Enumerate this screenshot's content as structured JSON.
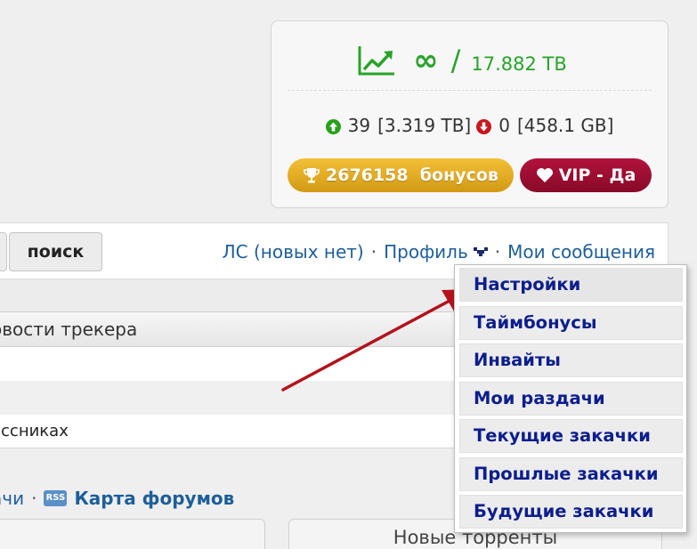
{
  "stats": {
    "ratio_symbol": "∞",
    "slash": "/",
    "total_upload": "17.882 TB",
    "seeding_count": "39",
    "seeding_size": "[3.319 TB]",
    "leeching_count": "0",
    "leeching_size": "[458.1 GB]",
    "bonus_label": "2676158  бонусов",
    "vip_label": "VIP - Да",
    "colors": {
      "ratio_green": "#29a329",
      "bonus_gold": "#e0ab22",
      "vip_red": "#9c0e31"
    }
  },
  "nav": {
    "search_label": "поиск",
    "pm_link": "ЛС (новых нет)",
    "profile_link": "Профиль",
    "messages_link": "Мои сообщения",
    "separator": "·"
  },
  "content": {
    "news_header": "овости трекера",
    "row3_text": "ассниках",
    "forum_link_1": "ачи",
    "forum_link_2": "Карта форумов",
    "rss_badge": "RSS",
    "new_torrents_header": "Новые торренты"
  },
  "dropdown": {
    "items": [
      "Настройки",
      "Таймбонусы",
      "Инвайты",
      "Мои раздачи",
      "Текущие закачки",
      "Прошлые закачки",
      "Будущие закачки"
    ],
    "color": "#0d1e8c"
  },
  "annotation": {
    "arrow_color": "#b3121c"
  }
}
